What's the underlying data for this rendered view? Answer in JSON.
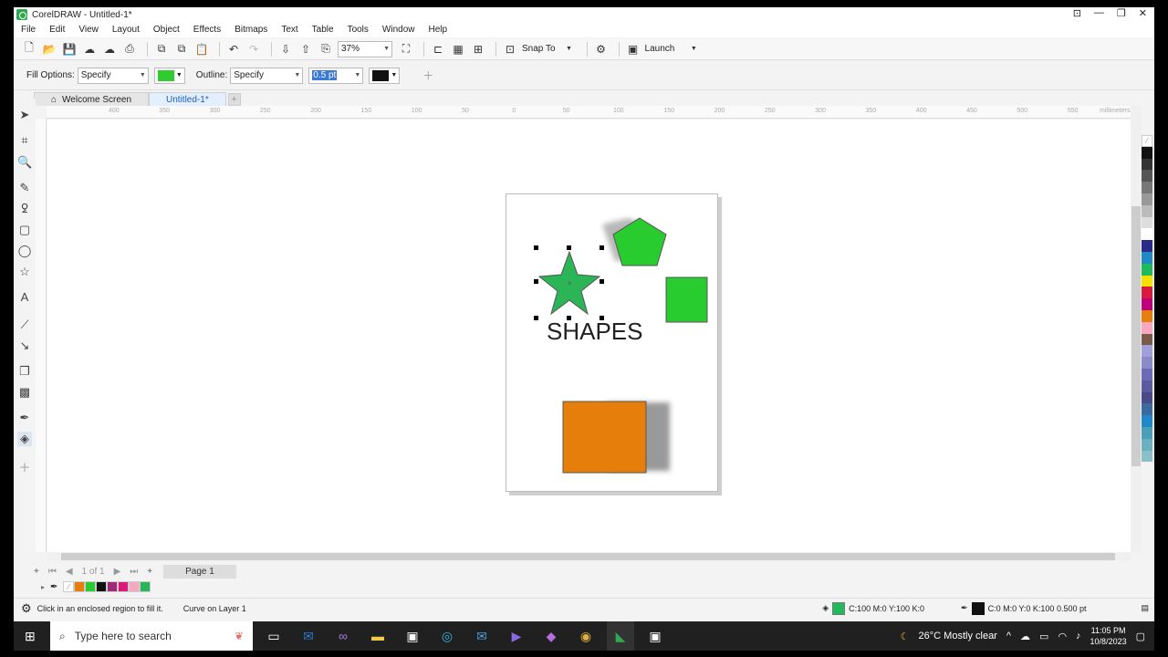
{
  "window": {
    "title": "CorelDRAW - Untitled-1*"
  },
  "menu": [
    "File",
    "Edit",
    "View",
    "Layout",
    "Object",
    "Effects",
    "Bitmaps",
    "Text",
    "Table",
    "Tools",
    "Window",
    "Help"
  ],
  "toolbar": {
    "zoom": "37%",
    "snap_label": "Snap To",
    "launch_label": "Launch"
  },
  "propbar": {
    "fill_label": "Fill Options:",
    "fill_value": "Specify",
    "fill_color": "#2ecc2e",
    "outline_label": "Outline:",
    "outline_value": "Specify",
    "outline_width": "0.5 pt",
    "outline_color": "#111111"
  },
  "tabs": [
    {
      "label": "Welcome Screen"
    },
    {
      "label": "Untitled-1*"
    }
  ],
  "rulers": {
    "h": [
      "400",
      "350",
      "300",
      "250",
      "200",
      "150",
      "100",
      "50",
      "0",
      "50",
      "100",
      "150",
      "200",
      "250",
      "300",
      "350",
      "400",
      "450",
      "500",
      "550"
    ],
    "unit": "millimeters"
  },
  "canvas": {
    "text": "SHAPES",
    "star_color": "#2bb556",
    "pentagon_color": "#29cc2e",
    "square_color": "#29cc2e",
    "orange_color": "#e67e0c"
  },
  "pagenav": {
    "counter": "1 of 1",
    "page_tab": "Page 1"
  },
  "doc_palette": [
    "#ffffff",
    "#e67e0c",
    "#29cc2e",
    "#111111",
    "#a0297a",
    "#d81b7a",
    "#f7a8c0",
    "#2bb556"
  ],
  "palette": [
    "#111111",
    "#333333",
    "#555555",
    "#777777",
    "#999999",
    "#bbbbbb",
    "#dddddd",
    "#ffffff",
    "#2a2a8a",
    "#1e88c8",
    "#1fba5a",
    "#f5e000",
    "#d81b3c",
    "#c0007a",
    "#e67e0c",
    "#f7a8c0",
    "#7a5a4a",
    "#a0a0d8",
    "#8a8ac8",
    "#6a6ab8",
    "#5a5aa0",
    "#4a4a88",
    "#3a6aa0",
    "#1e88c8",
    "#4aa0b8",
    "#6ab0c0",
    "#8ac0c8"
  ],
  "status": {
    "hint": "Click in an enclosed region to fill it.",
    "object": "Curve on Layer 1",
    "fill_info": "C:100 M:0 Y:100 K:0",
    "outline_info": "C:0 M:0 Y:0 K:100  0.500 pt"
  },
  "taskbar": {
    "search_placeholder": "Type here to search",
    "weather": "26°C  Mostly clear",
    "time": "11:05 PM",
    "date": "10/8/2023"
  }
}
